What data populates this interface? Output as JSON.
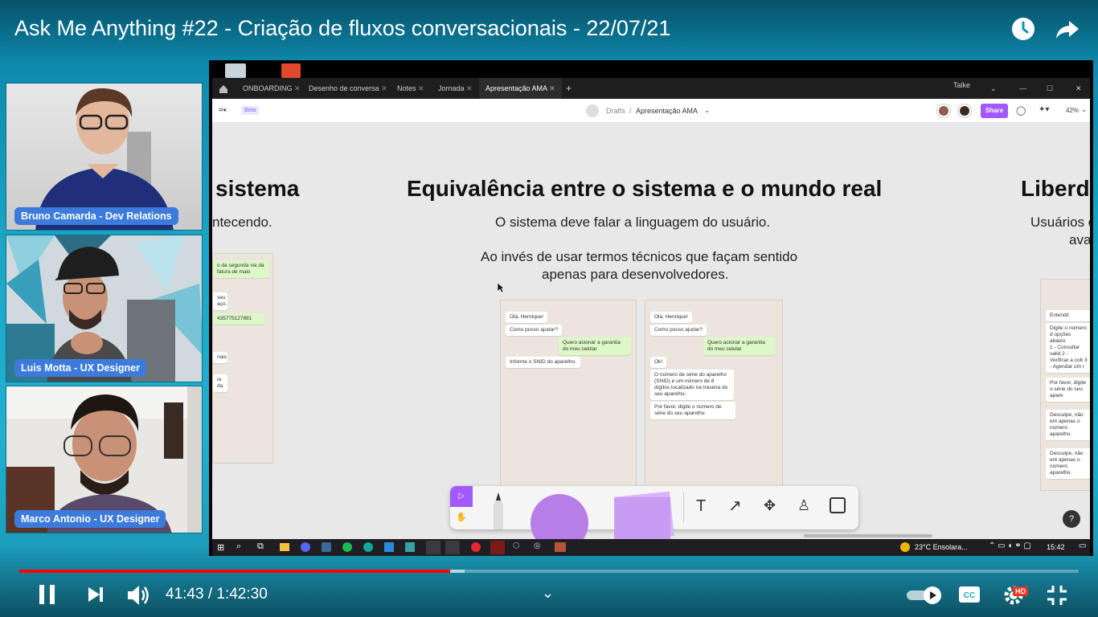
{
  "video": {
    "title": "Ask Me Anything #22 - Criação de fluxos conversacionais - 22/07/21",
    "current_time": "41:43",
    "duration": "1:42:30",
    "time_separator": " / ",
    "progress": 0.407,
    "buffered": 0.42,
    "hd_badge": "HD"
  },
  "participants": [
    {
      "name": "Bruno Camarda - Dev Relations"
    },
    {
      "name": "Luis Motta - UX Designer"
    },
    {
      "name": "Marco Antonio - UX Designer"
    }
  ],
  "figma": {
    "tabs": [
      "ONBOARDING",
      "Desenho de conversa",
      "Notes",
      "Jornada",
      "Apresentação AMA"
    ],
    "active_tab": "Apresentação AMA",
    "window_user": "Talke",
    "beta_badge": "Beta",
    "breadcrumb_root": "Drafts",
    "breadcrumb_sep": "/",
    "breadcrumb_file": "Apresentação AMA",
    "share_label": "Share",
    "zoom": "42%",
    "help": "?"
  },
  "slide": {
    "left_title": "sistema",
    "left_sub": "ntecendo.",
    "title": "Equivalência entre o sistema e o mundo real",
    "line1": "O sistema deve falar a linguagem do usuário.",
    "line2": "Ao invés de usar termos técnicos que façam sentido",
    "line3": "apenas para desenvolvedores.",
    "right_title": "Liberda",
    "right_sub1": "Usuários c",
    "right_sub2": "ava"
  },
  "chat_left_edge": {
    "b1": "o da segunda via da fatura de maio",
    "b2": "seu aço.",
    "b3": "435775127881",
    "b4": "nais",
    "b5": "ia da"
  },
  "chat_a": {
    "m1": "Olá, Henrique!",
    "m2": "Como posso ajudar?",
    "m3": "Quero acionar a garantia do meu celular",
    "m4": "Informe o SNID do aparelho."
  },
  "chat_b": {
    "m1": "Olá, Henrique!",
    "m2": "Como posso ajudar?",
    "m3": "Quero acionar a garantia do meu celular",
    "m4": "Ok!",
    "m5": "O número de série do aparelho (SNID) é um número de 8 dígitos localizado na traseira do seu aparelho.",
    "m6": "Por favor, digite o número de série do seu aparelho."
  },
  "chat_right_edge": {
    "r1": "Entendi!",
    "r2": "Digite o número d opções abaixo:",
    "r3": "1 - Consultar valid 2 - Verificar a cob 3 - Agendar um r",
    "r4": "Por favor, digite o série do seu apare",
    "r5": "Desculpe, não ent apenas o número aparelho.",
    "r6": "Desculpe, não ent apenas o número aparelho."
  },
  "taskbar": {
    "weather": "23°C  Ensolara...",
    "clock": "15:42"
  },
  "colors": {
    "accent_blue": "#3c7bdb",
    "progress_red": "#ff0000",
    "figma_purple": "#a259ff",
    "background": "#1aa6c7"
  }
}
